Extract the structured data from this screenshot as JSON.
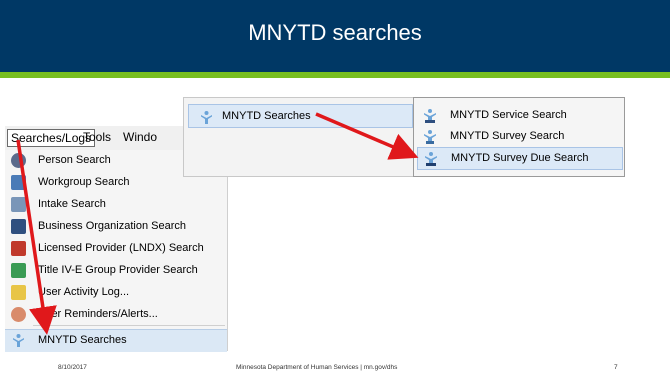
{
  "slide": {
    "title": "MNYTD searches"
  },
  "menu_bar": {
    "items": [
      "Searches/Logs",
      "Tools",
      "Windo"
    ]
  },
  "dropdown": {
    "items": [
      "Person Search",
      "Workgroup Search",
      "Intake Search",
      "Business Organization Search",
      "Licensed Provider (LNDX) Search",
      "Title IV-E Group Provider Search",
      "User Activity Log...",
      "User Reminders/Alerts...",
      "MNYTD Searches"
    ]
  },
  "submenu": {
    "parent": "MNYTD Searches",
    "items": [
      "MNYTD Service Search",
      "MNYTD Survey Search",
      "MNYTD Survey Due Search"
    ]
  },
  "footer": {
    "date": "8/10/2017",
    "center": "Minnesota Department of Human Services | mn.gov/dhs",
    "page": "7"
  },
  "colors": {
    "header": "#003865",
    "stripe": "#78be20",
    "arrow": "#e0181b",
    "highlight": "#dce9f7"
  }
}
